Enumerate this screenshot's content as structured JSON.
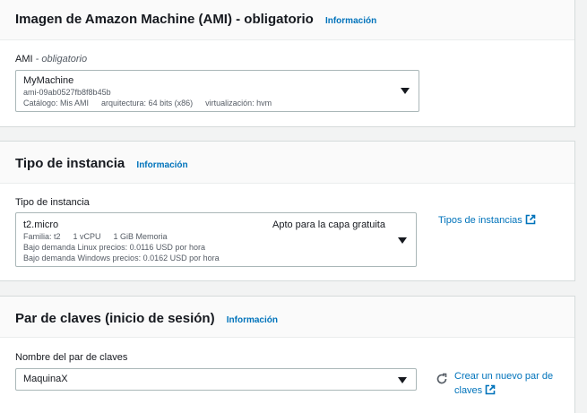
{
  "ami": {
    "title": "Imagen de Amazon Machine (AMI) - obligatorio",
    "info": "Información",
    "label": "AMI",
    "label_suffix": " - obligatorio",
    "selected_name": "MyMachine",
    "selected_id": "ami-09ab0527fb8f8b45b",
    "catalog": "Catálogo: Mis AMI",
    "architecture": "arquitectura: 64 bits (x86)",
    "virtualization": "virtualización: hvm"
  },
  "instance": {
    "title": "Tipo de instancia",
    "info": "Información",
    "label": "Tipo de instancia",
    "selected_name": "t2.micro",
    "free_tier": "Apto para la capa gratuita",
    "family": "Familia: t2",
    "vcpu": "1 vCPU",
    "memory": "1 GiB Memoria",
    "linux_price": "Bajo demanda Linux precios: 0.0116 USD por hora",
    "windows_price": "Bajo demanda Windows precios: 0.0162 USD por hora",
    "types_link": "Tipos de instancias"
  },
  "keypair": {
    "title": "Par de claves (inicio de sesión)",
    "info": "Información",
    "label": "Nombre del par de claves",
    "selected": "MaquinaX",
    "create_line1": "Crear un nuevo par de",
    "create_line2": "claves"
  },
  "colors": {
    "link": "#0073bb",
    "border": "#aab7b8",
    "background": "#f2f3f3"
  },
  "icons": [
    "caret-down-icon",
    "external-link-icon",
    "refresh-icon"
  ]
}
